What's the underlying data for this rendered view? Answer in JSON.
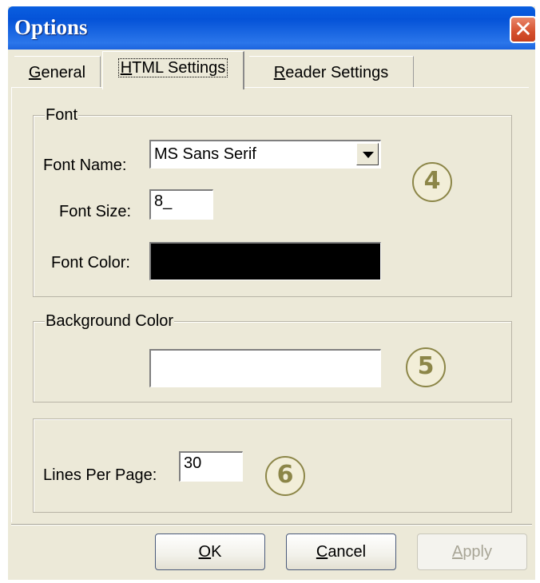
{
  "window": {
    "title": "Options",
    "close_glyph": "✕"
  },
  "tabs": [
    {
      "accel": "G",
      "rest": "eneral",
      "active": false
    },
    {
      "accel": "H",
      "rest": "TML Settings",
      "active": true
    },
    {
      "accel": "R",
      "rest": "eader Settings",
      "active": false
    }
  ],
  "font_group": {
    "legend": "Font",
    "font_name_label": "Font Name:",
    "font_name_value": "MS Sans Serif",
    "font_size_label": "Font Size:",
    "font_size_value": "8_",
    "font_color_label": "Font Color:",
    "font_color_value": "#000000",
    "callout": "4"
  },
  "background_group": {
    "legend": "Background Color",
    "color_value": "#ffffff",
    "callout": "5"
  },
  "lines_group": {
    "label": "Lines Per Page:",
    "value": "30",
    "callout": "6"
  },
  "buttons": {
    "ok": {
      "accel": "O",
      "rest": "K"
    },
    "cancel": {
      "accel": "C",
      "rest": "ancel"
    },
    "apply": {
      "accel": "A",
      "rest": "pply",
      "disabled": true
    }
  },
  "icons": {
    "close": "close-icon",
    "dropdown": "chevron-down-icon"
  },
  "colors": {
    "titlebar": "#0553d8",
    "dialog": "#ece9d8",
    "callout": "#8c8648"
  }
}
